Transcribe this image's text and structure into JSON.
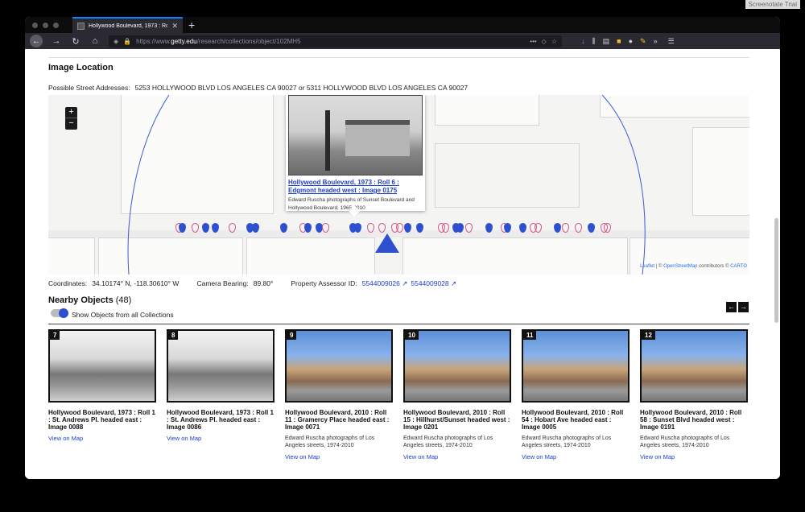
{
  "overlay_label": "Screenotate Trial",
  "browser": {
    "tab_title": "Hollywood Boulevard, 1973 : Ro",
    "url_prefix": "https://www.",
    "url_domain": "getty.edu",
    "url_path": "/research/collections/object/102MH5"
  },
  "image_location": {
    "heading": "Image Location",
    "address_label": "Possible Street Addresses:",
    "address_value": "5253 HOLLYWOOD BLVD LOS ANGELES CA 90027 or 5311 HOLLYWOOD BLVD LOS ANGELES CA 90027"
  },
  "map": {
    "zoom_in": "+",
    "zoom_out": "−",
    "popup_title": "Hollywood Boulevard, 1973 : Roll 6 : Edgmont headed west : Image 0175",
    "popup_subtitle": "Edward Ruscha photographs of Sunset Boulevard and Hollywood Boulevard, 1965-2010",
    "attribution_leaflet": "Leaflet",
    "attribution_sep": " | © ",
    "attribution_osm": "OpenStreetMap",
    "attribution_contrib": " contributors © ",
    "attribution_carto": "CARTO"
  },
  "coordinates": {
    "label": "Coordinates:",
    "value": "34.10174° N, -118.30610° W",
    "bearing_label": "Camera Bearing:",
    "bearing_value": "89.80°",
    "assessor_label": "Property Assessor ID:",
    "assessor_id_1": "5544009026 ↗",
    "assessor_id_2": "5544009028 ↗"
  },
  "nearby": {
    "title": "Nearby Objects",
    "count": "(48)",
    "toggle_label": "Show Objects from all Collections",
    "prev": "←",
    "next": "→",
    "cards": [
      {
        "num": "7",
        "title": "Hollywood Boulevard, 1973 : Roll 1 : St. Andrews Pl. headed east : Image 0088",
        "subtitle": "",
        "link": "View on Map"
      },
      {
        "num": "8",
        "title": "Hollywood Boulevard, 1973 : Roll 1 : St. Andrews Pl. headed east : Image 0086",
        "subtitle": "",
        "link": "View on Map"
      },
      {
        "num": "9",
        "title": "Hollywood Boulevard, 2010 : Roll 11 : Gramercy Place headed east : Image 0071",
        "subtitle": "Edward Ruscha photographs of Los Angeles streets, 1974-2010",
        "link": "View on Map"
      },
      {
        "num": "10",
        "title": "Hollywood Boulevard, 2010 : Roll 15 : Hillhurst/Sunset headed west : Image 0201",
        "subtitle": "Edward Ruscha photographs of Los Angeles streets, 1974-2010",
        "link": "View on Map"
      },
      {
        "num": "11",
        "title": "Hollywood Boulevard, 2010 : Roll 54 : Hobart Ave headed east : Image 0005",
        "subtitle": "Edward Ruscha photographs of Los Angeles streets, 1974-2010",
        "link": "View on Map"
      },
      {
        "num": "12",
        "title": "Hollywood Boulevard, 2010 : Roll 58 : Sunset Blvd headed west : Image 0191",
        "subtitle": "Edward Ruscha photographs of Los Angeles streets, 1974-2010",
        "link": "View on Map"
      }
    ]
  }
}
